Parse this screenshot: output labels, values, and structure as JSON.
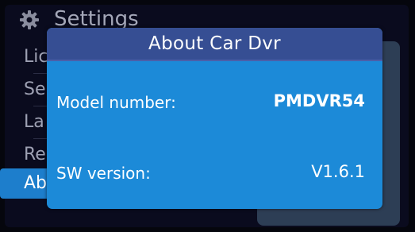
{
  "background": {
    "title": "Settings",
    "menu_items": [
      {
        "label": "Lic"
      },
      {
        "label": "Se"
      },
      {
        "label": "La"
      },
      {
        "label": "Re"
      },
      {
        "label": "Ab",
        "selected": true
      }
    ]
  },
  "dialog": {
    "title": "About Car Dvr",
    "rows": [
      {
        "label": "Model number:",
        "value": "PMDVR54"
      },
      {
        "label": "SW version:",
        "value": "V1.6.1"
      }
    ]
  },
  "icons": {
    "settings": "gear-icon"
  },
  "colors": {
    "dialog_body": "#1c8ad8",
    "dialog_header": "#364e93",
    "selected_item": "#1d7ecc",
    "background": "#0a0b1e"
  }
}
